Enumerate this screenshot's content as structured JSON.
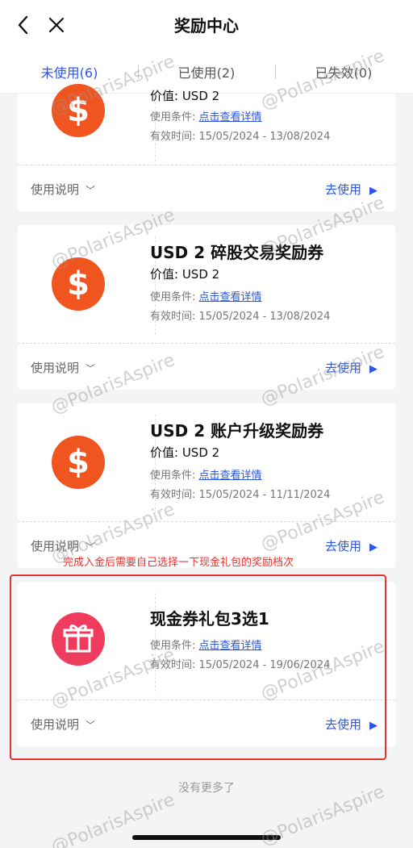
{
  "header": {
    "title": "奖励中心"
  },
  "tabs": [
    {
      "label": "未使用(6)"
    },
    {
      "label": "已使用(2)"
    },
    {
      "label": "已失效(0)"
    }
  ],
  "cards": [
    {
      "title": "",
      "value": "价值: USD 2",
      "condition_label": "使用条件:",
      "condition_link": "点击查看详情",
      "validity_label": "有效时间:",
      "validity": "15/05/2024 - 13/08/2024",
      "usage": "使用说明",
      "use": "去使用"
    },
    {
      "title": "USD 2 碎股交易奖励券",
      "value": "价值: USD 2",
      "condition_label": "使用条件:",
      "condition_link": "点击查看详情",
      "validity_label": "有效时间:",
      "validity": "15/05/2024 - 13/08/2024",
      "usage": "使用说明",
      "use": "去使用"
    },
    {
      "title": "USD 2 账户升级奖励券",
      "value": "价值: USD 2",
      "condition_label": "使用条件:",
      "condition_link": "点击查看详情",
      "validity_label": "有效时间:",
      "validity": "15/05/2024 - 11/11/2024",
      "usage": "使用说明",
      "use": "去使用"
    },
    {
      "title": "现金券礼包3选1",
      "condition_label": "使用条件:",
      "condition_link": "点击查看详情",
      "validity_label": "有效时间:",
      "validity": "15/05/2024 - 19/06/2024",
      "usage": "使用说明",
      "use": "去使用"
    }
  ],
  "annotation": "完成入金后需要自己选择一下现金礼包的奖励档次",
  "footer": {
    "no_more": "没有更多了"
  },
  "watermark": "@PolarisAspire",
  "colors": {
    "accent": "#2b56e8",
    "coin": "#f0541f",
    "gift": "#ee3b5e",
    "annotation": "#e8322e"
  }
}
